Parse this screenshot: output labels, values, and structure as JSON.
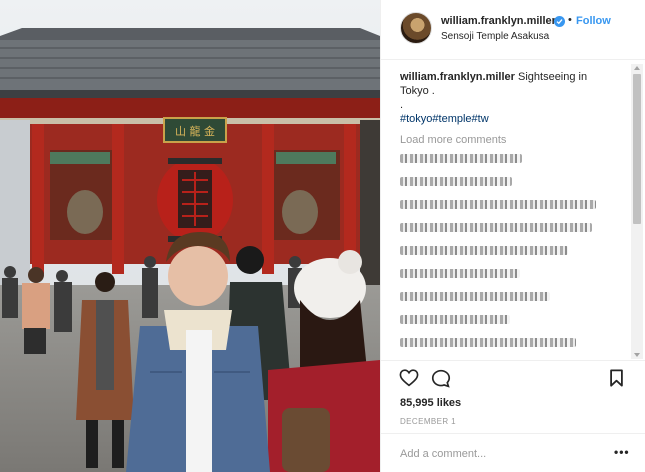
{
  "post": {
    "username": "william.franklyn.miller",
    "follow_label": "Follow",
    "separator": "•",
    "location": "Sensoji Temple Asakusa",
    "photo_alt": "",
    "photo_sign": "山 龍 金"
  },
  "caption": {
    "username": "william.franklyn.miller",
    "text": "Sightseeing in Tokyo .",
    "dot": ".",
    "hashtags": "#tokyo#temple#tw"
  },
  "comments": {
    "load_more": "Load more comments",
    "blurred_lines": 14
  },
  "actions": {
    "likes": "85,995 likes",
    "date": "DECEMBER 1",
    "comment_placeholder": "Add a comment...",
    "more_label": "•••"
  },
  "icons": {
    "like": "heart-icon",
    "comment": "comment-bubble-icon",
    "save": "bookmark-icon",
    "verified": "verified-badge-icon"
  },
  "colors": {
    "accent": "#3897f0",
    "hashtag": "#003569",
    "muted": "#999999",
    "temple_red": "#a8281f"
  }
}
